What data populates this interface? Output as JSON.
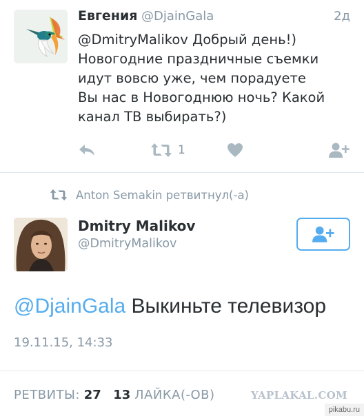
{
  "tweet1": {
    "author_name": "Евгения",
    "handle": "@DjainGala",
    "time": "2д",
    "text_lines": [
      "@DmitryMalikov Добрый день!)",
      "Новогодние праздничные съемки",
      "идут вовсю уже, чем порадуете",
      "Вы нас в Новогоднюю ночь? Какой",
      "канал ТВ выбирать?)"
    ],
    "retweet_count": "1",
    "icons": {
      "reply": "reply-icon",
      "retweet": "retweet-icon",
      "like": "heart-icon",
      "follow": "follow-icon"
    }
  },
  "retweet_banner": {
    "text": "Anton Semakin ретвитнул(-а)",
    "icon": "retweet-icon"
  },
  "tweet2": {
    "author_name": "Dmitry Malikov",
    "handle": "@DmitryMalikov",
    "mention": "@DjainGala",
    "text": " Выкиньте телевизор",
    "date": "19.11.15, 14:33",
    "follow_icon": "follow-icon"
  },
  "stats": {
    "retweets_label": "РЕТВИТЫ:",
    "retweets_count": "27",
    "likes_count": "13",
    "likes_label": "ЛАЙКА(-ОВ)"
  },
  "watermarks": {
    "site": "YAPLAKAL.COM",
    "corner": "pikabu.ru"
  },
  "colors": {
    "accent": "#55acee",
    "muted": "#8899a6",
    "text": "#292f33"
  }
}
